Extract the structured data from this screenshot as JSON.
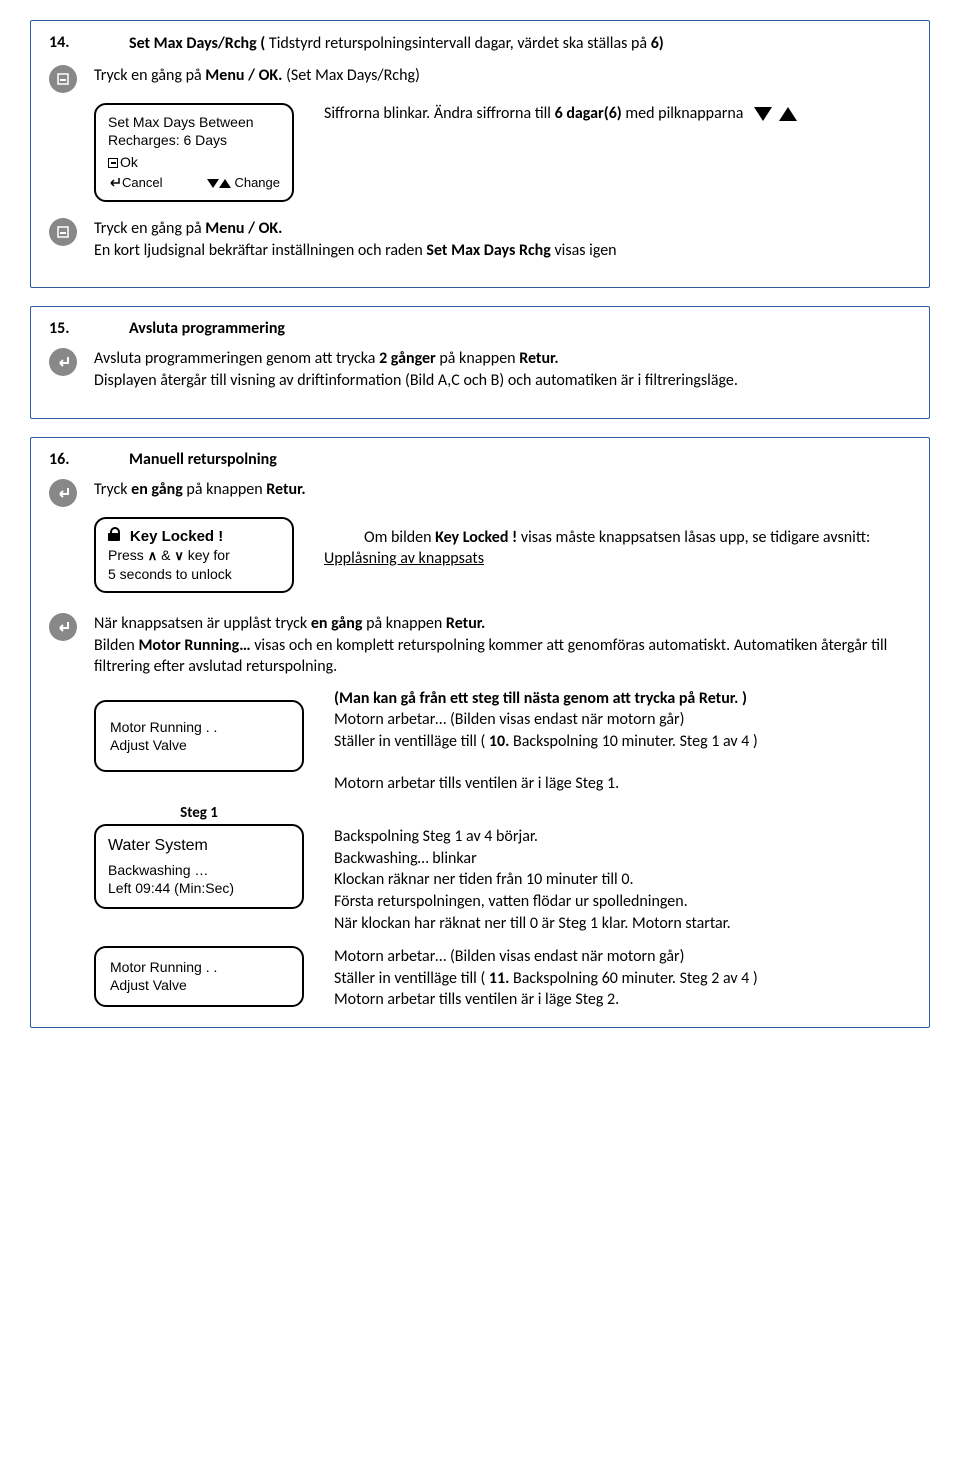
{
  "s14": {
    "num": "14.",
    "title_a": "Set Max Days/Rchg (",
    "title_b": " Tidstyrd returspolningsintervall dagar, värdet ska ställas på ",
    "title_c": "6)",
    "press1_a": "Tryck en gång på ",
    "press1_b": "Menu / OK.",
    "press1_c": " (Set Max Days/Rchg)",
    "lcd1_l1": "Set Max Days Between",
    "lcd1_l2": "Recharges: 6 Days",
    "lcd1_ok": "Ok",
    "lcd1_cancel": "Cancel",
    "lcd1_change": "Change",
    "right1_a": "Siffrorna blinkar. Ändra siffrorna till ",
    "right1_b": "6 dagar(6)",
    "right1_c": " med pilknapparna",
    "press2_a": "Tryck en gång på ",
    "press2_b": "Menu / OK.",
    "confirm_a": "En kort ljudsignal bekräftar inställningen och raden ",
    "confirm_b": "Set Max Days Rchg",
    "confirm_c": " visas igen"
  },
  "s15": {
    "num": "15.",
    "title": "Avsluta programmering",
    "l1_a": "Avsluta programmeringen genom att trycka ",
    "l1_b": "2 gånger",
    "l1_c": " på knappen ",
    "l1_d": "Retur.",
    "l2": "Displayen återgår till visning av driftinformation (Bild A,C och B) och automatiken är i filtreringsläge."
  },
  "s16": {
    "num": "16.",
    "title": "Manuell returspolning",
    "press_a": "Tryck ",
    "press_b": "en gång",
    "press_c": " på knappen ",
    "press_d": "Retur.",
    "keylock_l1": "Key Locked !",
    "keylock_l2a": "Press ",
    "keylock_l2b": " & ",
    "keylock_l2c": " key for",
    "keylock_l3": "5 seconds to unlock",
    "kl_right_a": "Om bilden ",
    "kl_right_b": "Key Locked !",
    "kl_right_c": " visas måste knappsatsen låsas upp, se tidigare avsnitt: ",
    "kl_right_d": "Upplåsning av knappsats",
    "after_a": "När knappsatsen är upplåst tryck ",
    "after_b": "en gång",
    "after_c": " på knappen ",
    "after_d": "Retur.",
    "after2_a": "Bilden ",
    "after2_b": "Motor Running…",
    "after2_c": " visas och en komplett returspolning kommer att genomföras automatiskt. Automatiken återgår till filtrering efter avslutad returspolning.",
    "bold_line": "(Man kan gå från ett steg till nästa genom att trycka på Retur. )",
    "motor1_l1": "Motor Running . .",
    "motor1_l2": "Adjust Valve",
    "m1_t1": "Motorn arbetar… (Bilden visas endast när motorn går)",
    "m1_t2_a": "Ställer in ventilläge till ( ",
    "m1_t2_b": "10.",
    "m1_t2_c": " Backspolning 10 minuter. Steg 1 av 4 )",
    "m1_gap": "Motorn arbetar tills ventilen är i läge Steg 1.",
    "step1": "Steg 1",
    "ws_l1": "Water System",
    "ws_l2": "Backwashing …",
    "ws_l3": "Left 09:44 (Min:Sec)",
    "ws_t1": "Backspolning Steg 1 av 4 börjar.",
    "ws_t2": "Backwashing… blinkar",
    "ws_t3": "Klockan räknar ner tiden från 10 minuter till 0.",
    "ws_t4": "Första returspolningen, vatten flödar ur spolledningen.",
    "ws_t5": "När klockan har räknat ner till 0 är Steg 1 klar. Motorn startar.",
    "motor2_l1": "Motor Running . .",
    "motor2_l2": "Adjust Valve",
    "m2_t1": "Motorn arbetar… (Bilden visas endast när motorn går)",
    "m2_t2_a": "Ställer in ventilläge till ( ",
    "m2_t2_b": "11.",
    "m2_t2_c": "  Backspolning 60 minuter. Steg 2 av 4 )",
    "m2_t3": "Motorn arbetar tills ventilen är i läge Steg 2."
  }
}
